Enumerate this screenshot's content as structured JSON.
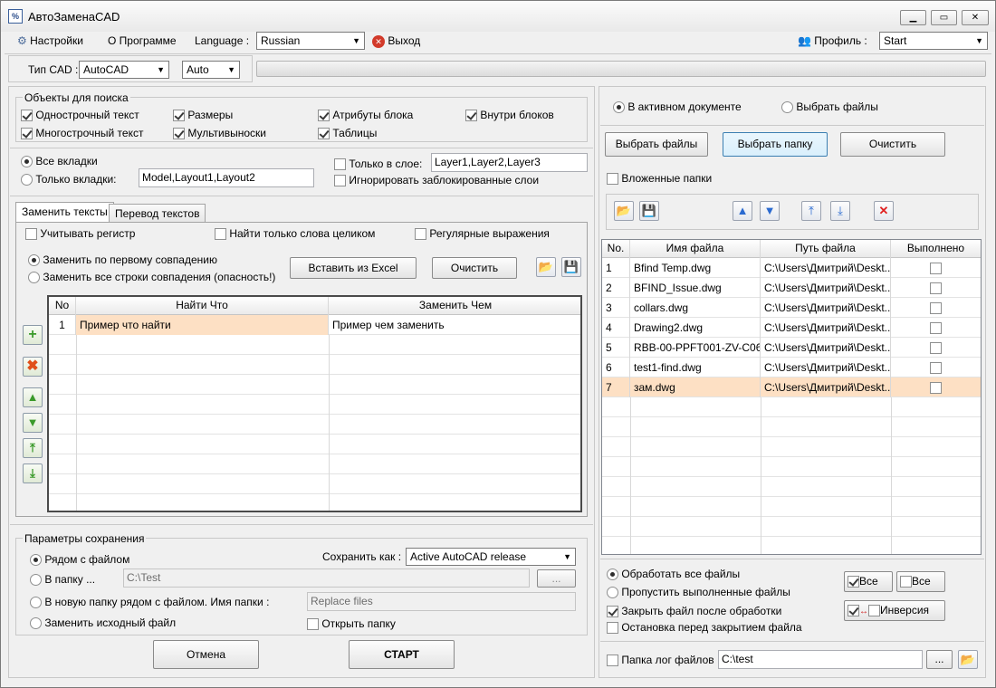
{
  "window": {
    "title": "АвтоЗаменаCAD",
    "app_icon": "autocad-replace-icon"
  },
  "menu": {
    "settings": "Настройки",
    "about": "О Программе",
    "language_label": "Language :",
    "language_value": "Russian",
    "exit": "Выход",
    "profile_label": "Профиль :",
    "profile_value": "Start"
  },
  "toolbar": {
    "cad_type_label": "Тип CAD :",
    "cad_type_value": "AutoCAD",
    "mode_value": "Auto"
  },
  "search_objects": {
    "title": "Объекты для поиска",
    "items": [
      {
        "label": "Однострочный текст",
        "checked": true
      },
      {
        "label": "Размеры",
        "checked": true
      },
      {
        "label": "Атрибуты блока",
        "checked": true
      },
      {
        "label": "Внутри блоков",
        "checked": true
      },
      {
        "label": "Многострочный текст",
        "checked": true
      },
      {
        "label": "Мультивыноски",
        "checked": true
      },
      {
        "label": "Таблицы",
        "checked": true
      }
    ]
  },
  "scope": {
    "all_tabs": "Все вкладки",
    "only_tabs": "Только вкладки:",
    "only_tabs_value": "Model,Layout1,Layout2",
    "only_layer": "Только в слое:",
    "only_layer_value": "Layer1,Layer2,Layer3",
    "ignore_locked": "Игнорировать заблокированные слои"
  },
  "tabs": {
    "replace": "Заменить тексты",
    "translate": "Перевод текстов"
  },
  "options": {
    "match_case": "Учитывать регистр",
    "whole_words": "Найти только слова целиком",
    "regex": "Регулярные выражения",
    "first_match": "Заменить по первому совпадению",
    "all_matches": "Заменить все строки совпадения (опасность!)",
    "paste_excel": "Вставить из Excel",
    "clear": "Очистить"
  },
  "replace_table": {
    "headers": [
      "No",
      "Найти Что",
      "Заменить Чем"
    ],
    "rows": [
      {
        "no": "1",
        "find": "Пример что найти",
        "replace": "Пример чем заменить"
      }
    ]
  },
  "save": {
    "title": "Параметры сохранения",
    "next_to_file": "Рядом с файлом",
    "to_folder": "В папку ...",
    "folder_value": "C:\\Test",
    "browse": "...",
    "new_folder": "В новую папку рядом с файлом. Имя папки :",
    "new_folder_value": "Replace files",
    "replace_source": "Заменить исходный файл",
    "save_as_label": "Сохранить как :",
    "save_as_value": "Active AutoCAD release",
    "open_folder": "Открыть папку"
  },
  "actions": {
    "cancel": "Отмена",
    "start": "СТАРТ"
  },
  "source": {
    "active_doc": "В активном документе",
    "select_files": "Выбрать файлы"
  },
  "file_buttons": {
    "select_files": "Выбрать файлы",
    "select_folder": "Выбрать папку",
    "clear": "Очистить",
    "subfolders": "Вложенные папки"
  },
  "files_table": {
    "headers": [
      "No.",
      "Имя файла",
      "Путь файла",
      "Выполнено"
    ],
    "rows": [
      {
        "no": "1",
        "name": "Bfind Temp.dwg",
        "path": "C:\\Users\\Дмитрий\\Deskt...",
        "done": false
      },
      {
        "no": "2",
        "name": "BFIND_Issue.dwg",
        "path": "C:\\Users\\Дмитрий\\Deskt...",
        "done": false
      },
      {
        "no": "3",
        "name": "collars.dwg",
        "path": "C:\\Users\\Дмитрий\\Deskt...",
        "done": false
      },
      {
        "no": "4",
        "name": "Drawing2.dwg",
        "path": "C:\\Users\\Дмитрий\\Deskt...",
        "done": false
      },
      {
        "no": "5",
        "name": "RBB-00-PPFT001-ZV-C06-...",
        "path": "C:\\Users\\Дмитрий\\Deskt...",
        "done": false
      },
      {
        "no": "6",
        "name": "test1-find.dwg",
        "path": "C:\\Users\\Дмитрий\\Deskt...",
        "done": false
      },
      {
        "no": "7",
        "name": "зам.dwg",
        "path": "C:\\Users\\Дмитрий\\Deskt...",
        "done": false
      }
    ]
  },
  "process": {
    "all_files": "Обработать все файлы",
    "skip_done": "Пропустить выполненные файлы",
    "close_after": "Закрыть файл после обработки",
    "stop_before_close": "Остановка перед закрытием файла",
    "all_on": "Все",
    "all_off": "Все",
    "invert": "Инверсия"
  },
  "log": {
    "label": "Папка лог файлов",
    "value": "C:\\test",
    "browse": "..."
  }
}
